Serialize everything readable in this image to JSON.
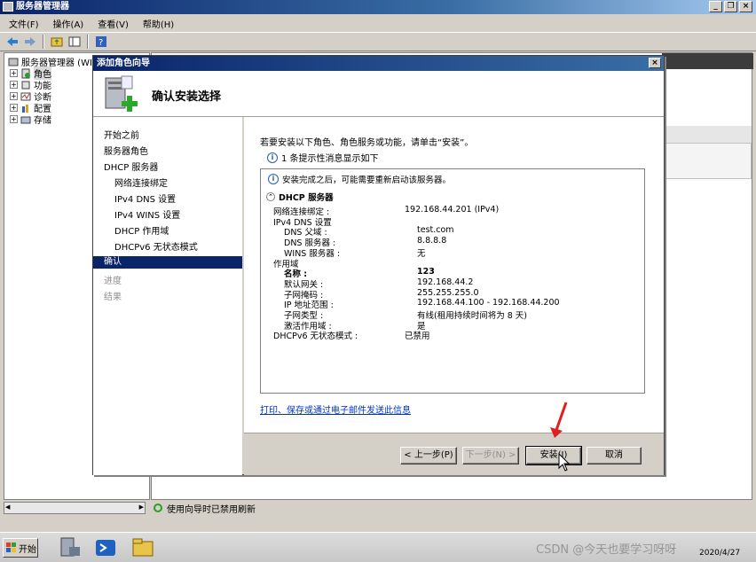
{
  "window": {
    "title": "服务器管理器",
    "min": "_",
    "restore": "ß",
    "close": "×"
  },
  "menu": [
    "文件(F)",
    "操作(A)",
    "查看(V)",
    "帮助(H)"
  ],
  "tree": {
    "root": "服务器管理器 (WI",
    "items": [
      "角色",
      "功能",
      "诊断",
      "配置",
      "存储"
    ]
  },
  "statusbar": {
    "text": "使用向导时已禁用刷新"
  },
  "dialog": {
    "title": "添加角色向导",
    "close": "×",
    "heading": "确认安装选择",
    "steps": [
      {
        "label": "开始之前",
        "level": 0,
        "state": "normal"
      },
      {
        "label": "服务器角色",
        "level": 0,
        "state": "normal"
      },
      {
        "label": "DHCP 服务器",
        "level": 0,
        "state": "normal"
      },
      {
        "label": "网络连接绑定",
        "level": 1,
        "state": "normal"
      },
      {
        "label": "IPv4 DNS 设置",
        "level": 1,
        "state": "normal"
      },
      {
        "label": "IPv4 WINS 设置",
        "level": 1,
        "state": "normal"
      },
      {
        "label": "DHCP 作用域",
        "level": 1,
        "state": "normal"
      },
      {
        "label": "DHCPv6 无状态模式",
        "level": 1,
        "state": "normal"
      },
      {
        "label": "确认",
        "level": 0,
        "state": "active"
      },
      {
        "label": "进度",
        "level": 0,
        "state": "dim"
      },
      {
        "label": "结果",
        "level": 0,
        "state": "dim"
      }
    ],
    "instruction": "若要安装以下角色、角色服务或功能，请单击“安装”。",
    "info_count": "1 条提示性消息显示如下",
    "restart_notice": "安装完成之后，可能需要重新启动该服务器。",
    "section": "DHCP 服务器",
    "details": [
      {
        "label": "网络连接绑定 :",
        "value": "192.168.44.201 (IPv4)",
        "indent": 0
      },
      {
        "label": "IPv4 DNS 设置",
        "value": "",
        "indent": 0
      },
      {
        "label": "DNS 父域 :",
        "value": "test.com",
        "indent": 1
      },
      {
        "label": "DNS 服务器 :",
        "value": "8.8.8.8",
        "indent": 1
      },
      {
        "label": "WINS 服务器 :",
        "value": "无",
        "indent": 1
      },
      {
        "label": "作用域",
        "value": "",
        "indent": 0
      },
      {
        "label": "名称 :",
        "value": "123",
        "indent": 1,
        "bold": true
      },
      {
        "label": "默认网关 :",
        "value": "192.168.44.2",
        "indent": 1
      },
      {
        "label": "子网掩码 :",
        "value": "255.255.255.0",
        "indent": 1
      },
      {
        "label": "IP 地址范围 :",
        "value": "192.168.44.100 - 192.168.44.200",
        "indent": 1
      },
      {
        "label": "子网类型 :",
        "value": "有线(租用持续时间将为 8 天)",
        "indent": 1
      },
      {
        "label": "激活作用域 :",
        "value": "是",
        "indent": 1
      },
      {
        "label": "DHCPv6 无状态模式 :",
        "value": "已禁用",
        "indent": 0
      }
    ],
    "print_link": "打印、保存或通过电子邮件发送此信息",
    "buttons": {
      "prev": "< 上一步(P)",
      "next": "下一步(N) >",
      "install": "安装(I)",
      "cancel": "取消"
    }
  },
  "taskbar": {
    "start": "开始",
    "watermark": "CSDN @今天也要学习呀呀",
    "clock": "2020/4/27"
  }
}
